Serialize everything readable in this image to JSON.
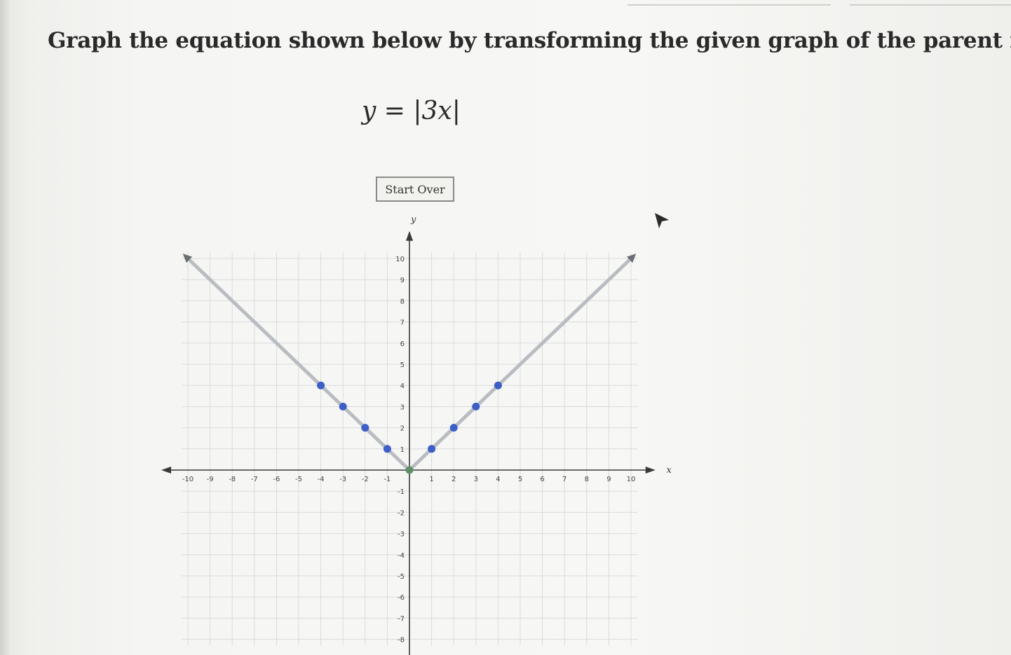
{
  "question": {
    "instruction": "Graph the equation shown below by transforming the given graph of the parent function.",
    "equation": "y = |3x|"
  },
  "controls": {
    "start_over_label": "Start Over"
  },
  "colors": {
    "point": "#3d5fc8",
    "vertex_point": "#5f8f6a",
    "graph_line": "#b9bdc1",
    "grid": "#d9dcde",
    "axis": "#3a3a3a"
  },
  "graph": {
    "x_axis_label": "x",
    "y_axis_label": "y",
    "x_ticks": [
      "-10",
      "-9",
      "-8",
      "-7",
      "-6",
      "-5",
      "-4",
      "-3",
      "-2",
      "-1",
      "1",
      "2",
      "3",
      "4",
      "5",
      "6",
      "7",
      "8",
      "9",
      "10"
    ],
    "y_ticks": [
      "10",
      "9",
      "8",
      "7",
      "6",
      "5",
      "4",
      "3",
      "2",
      "1",
      "-1",
      "-2",
      "-3",
      "-4",
      "-5",
      "-6",
      "-7",
      "-8"
    ],
    "x_range": [
      -10,
      10
    ],
    "y_range": [
      -8,
      10
    ],
    "line_left": {
      "from": [
        0,
        0
      ],
      "to": [
        -10,
        10
      ]
    },
    "line_right": {
      "from": [
        0,
        0
      ],
      "to": [
        10,
        10
      ]
    },
    "vertex": [
      0,
      0
    ],
    "points": [
      [
        -4,
        4
      ],
      [
        -3,
        3
      ],
      [
        -2,
        2
      ],
      [
        -1,
        1
      ],
      [
        1,
        1
      ],
      [
        2,
        2
      ],
      [
        3,
        3
      ],
      [
        4,
        4
      ]
    ]
  }
}
